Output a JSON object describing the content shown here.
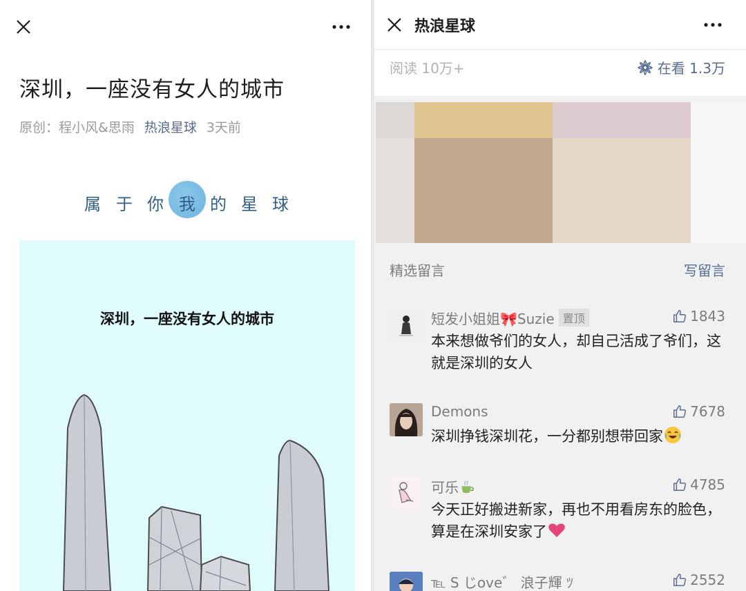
{
  "left": {
    "article_title": "深圳，一座没有女人的城市",
    "meta": {
      "author": "原创：程小风&思雨",
      "account": "热浪星球",
      "time": "3天前"
    },
    "planet_banner": [
      "属",
      "于",
      "你",
      "我",
      "的",
      "星",
      "球"
    ],
    "illustration_caption": "深圳，一座没有女人的城市"
  },
  "right": {
    "header_title": "热浪星球",
    "stats": {
      "reads": "阅读 10万+",
      "watching": "在看 1.3万"
    },
    "comments_label": "精选留言",
    "write_comment": "写留言",
    "comments": [
      {
        "name": "短发小姐姐🎀Suzie",
        "badge": "置顶",
        "likes": "1843",
        "text": "本来想做爷们的女人，却自己活成了爷们，这就是深圳的女人",
        "avatar": "avatar-girl-icon"
      },
      {
        "name": "Demons",
        "likes": "7678",
        "text": "深圳挣钱深圳花，一分都别想带回家",
        "emoji": "laughing-tears-icon",
        "avatar": "avatar-woman-icon"
      },
      {
        "name": "可乐",
        "name_emoji": "tea-icon",
        "likes": "4785",
        "text": "今天正好搬进新家，再也不用看房东的脸色，算是在深圳安家了",
        "emoji": "heart-icon",
        "avatar": "avatar-sketch-icon"
      },
      {
        "name": "℡ S じove゛ 浪子輝 ﾂ",
        "likes": "2552",
        "text": "",
        "avatar": "avatar-boy-icon"
      }
    ]
  },
  "colors": {
    "link": "#576b95",
    "muted": "#9a9a9a",
    "illustration_bg": "#dffbfb",
    "planet": "#7dbde6",
    "heart": "#e6457a"
  }
}
